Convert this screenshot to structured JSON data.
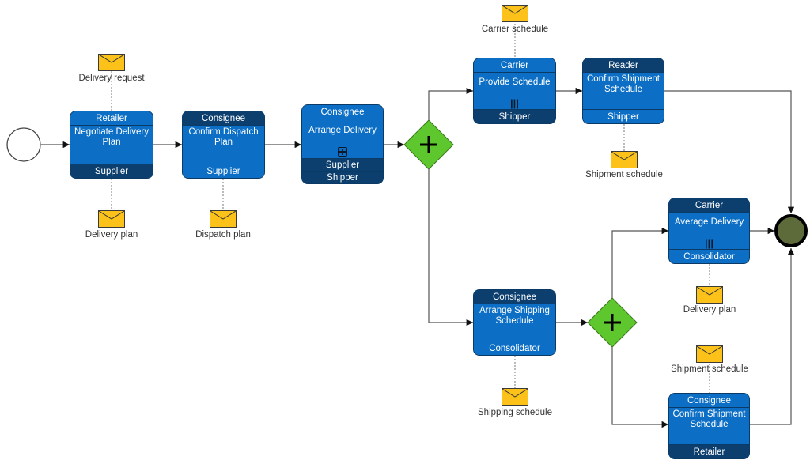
{
  "diagram": {
    "type": "BPMN choreography",
    "start_event": {
      "label": ""
    },
    "end_event": {
      "label": ""
    },
    "colors": {
      "task_fill": "#0c6fc5",
      "band_dark": "#0c3e6e",
      "gateway_fill": "#5ec72e",
      "message_fill": "#fcc21a",
      "end_fill": "#5d6b3a"
    },
    "tasks": [
      {
        "id": "t1",
        "top": "Retailer",
        "name": "Negotiate Delivery Plan",
        "bottom": [
          "Supplier"
        ],
        "marker": ""
      },
      {
        "id": "t2",
        "top": "Consignee",
        "name": "Confirm Dispatch Plan",
        "bottom": [
          "Supplier"
        ],
        "marker": ""
      },
      {
        "id": "t3",
        "top": "Consignee",
        "name": "Arrange Delivery",
        "bottom": [
          "Supplier",
          "Shipper"
        ],
        "marker": "subprocess"
      },
      {
        "id": "t4",
        "top": "Carrier",
        "name": "Provide Schedule",
        "bottom": [
          "Shipper"
        ],
        "marker": "parallel"
      },
      {
        "id": "t5",
        "top": "Reader",
        "name": "Confirm Shipment Schedule",
        "bottom": [
          "Shipper"
        ],
        "marker": ""
      },
      {
        "id": "t6",
        "top": "Carrier",
        "name": "Average Delivery",
        "bottom": [
          "Consolidator"
        ],
        "marker": "parallel"
      },
      {
        "id": "t7",
        "top": "Consignee",
        "name": "Arrange Shipping Schedule",
        "bottom": [
          "Consolidator"
        ],
        "marker": ""
      },
      {
        "id": "t8",
        "top": "Consignee",
        "name": "Confirm Shipment Schedule",
        "bottom": [
          "Retailer"
        ],
        "marker": ""
      }
    ],
    "gateways": [
      {
        "id": "g1",
        "type": "parallel",
        "symbol": "+"
      },
      {
        "id": "g2",
        "type": "parallel",
        "symbol": "+"
      }
    ],
    "messages": [
      {
        "id": "m1",
        "label": "Delivery request"
      },
      {
        "id": "m2",
        "label": "Delivery plan"
      },
      {
        "id": "m3",
        "label": "Dispatch plan"
      },
      {
        "id": "m4",
        "label": "Carrier schedule"
      },
      {
        "id": "m5",
        "label": "Shipment schedule"
      },
      {
        "id": "m6",
        "label": "Delivery plan"
      },
      {
        "id": "m7",
        "label": "Shipping schedule"
      },
      {
        "id": "m8",
        "label": "Shipment schedule"
      }
    ],
    "markers": {
      "parallel": "|||"
    }
  }
}
